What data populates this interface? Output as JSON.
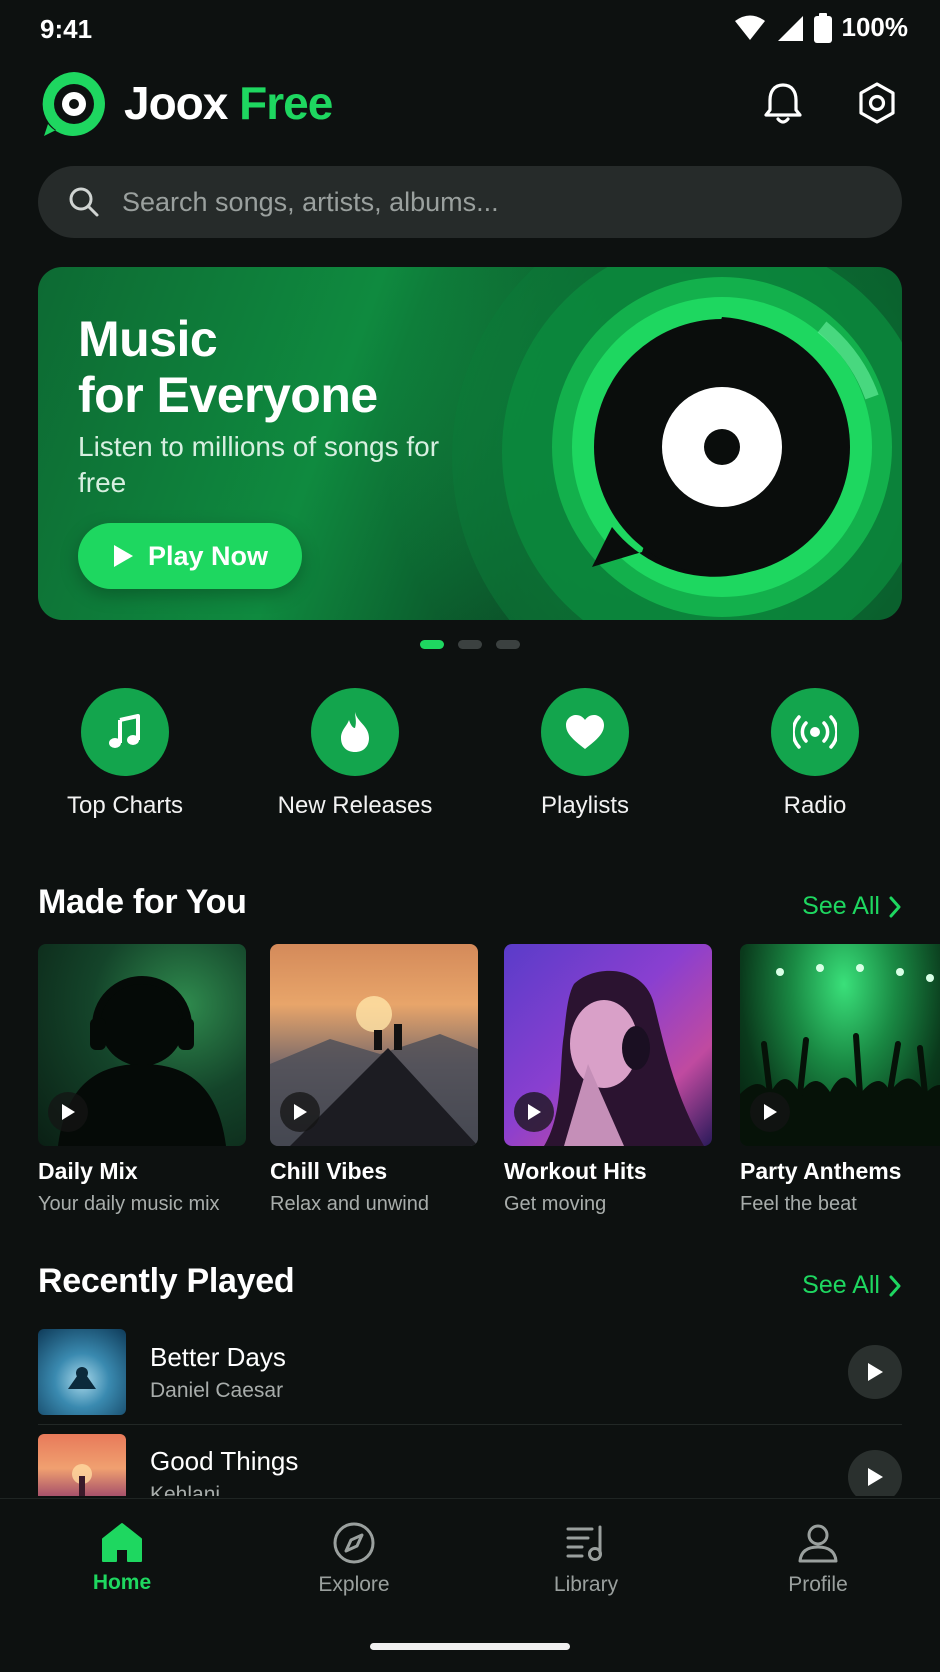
{
  "status": {
    "time": "9:41",
    "battery": "100%"
  },
  "header": {
    "title_main": "Joox",
    "title_accent": "Free"
  },
  "search": {
    "placeholder": "Search songs, artists, albums..."
  },
  "banner": {
    "title_line1": "Music",
    "title_line2": "for Everyone",
    "subtitle": "Listen to millions of songs for free",
    "button_label": "Play Now",
    "active_page": 1,
    "page_count": 3
  },
  "categories": [
    {
      "label": "Top Charts",
      "icon": "music-note-icon"
    },
    {
      "label": "New Releases",
      "icon": "flame-icon"
    },
    {
      "label": "Playlists",
      "icon": "heart-icon"
    },
    {
      "label": "Radio",
      "icon": "radio-icon"
    }
  ],
  "made_for_you": {
    "title": "Made for You",
    "see_all": "See All",
    "items": [
      {
        "title": "Daily Mix",
        "subtitle": "Your daily music mix"
      },
      {
        "title": "Chill Vibes",
        "subtitle": "Relax and unwind"
      },
      {
        "title": "Workout Hits",
        "subtitle": "Get moving"
      },
      {
        "title": "Party Anthems",
        "subtitle": "Feel the beat"
      }
    ]
  },
  "recently_played": {
    "title": "Recently Played",
    "see_all": "See All",
    "tracks": [
      {
        "title": "Better Days",
        "artist": "Daniel Caesar"
      },
      {
        "title": "Good Things",
        "artist": "Kehlani"
      }
    ]
  },
  "nav": {
    "items": [
      {
        "label": "Home",
        "icon": "home-icon",
        "active": true
      },
      {
        "label": "Explore",
        "icon": "compass-icon",
        "active": false
      },
      {
        "label": "Library",
        "icon": "library-icon",
        "active": false
      },
      {
        "label": "Profile",
        "icon": "profile-icon",
        "active": false
      }
    ]
  },
  "colors": {
    "accent": "#1ed760",
    "background": "#0d1110",
    "surface": "#262b2a"
  }
}
